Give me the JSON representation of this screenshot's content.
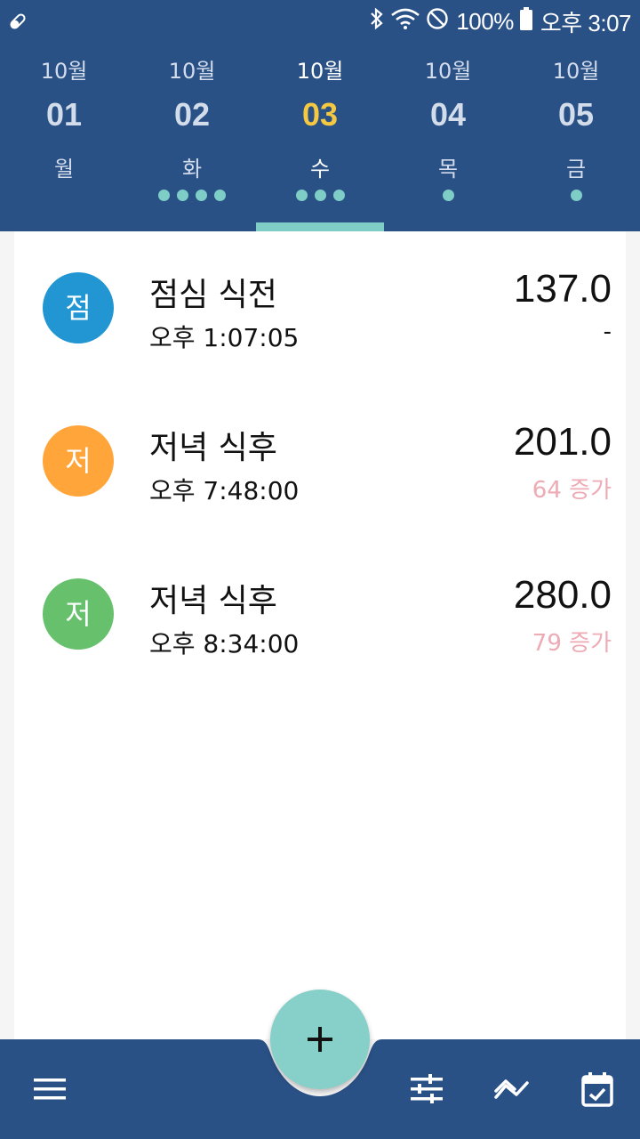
{
  "status_bar": {
    "battery": "100%",
    "time": "오후 3:07",
    "icons": [
      "pill-icon",
      "bluetooth-icon",
      "wifi-icon",
      "do-not-disturb-icon",
      "battery-icon"
    ]
  },
  "days": [
    {
      "month": "10월",
      "date": "01",
      "weekday": "월",
      "dots": 0,
      "selected": false
    },
    {
      "month": "10월",
      "date": "02",
      "weekday": "화",
      "dots": 4,
      "selected": false
    },
    {
      "month": "10월",
      "date": "03",
      "weekday": "수",
      "dots": 3,
      "selected": true
    },
    {
      "month": "10월",
      "date": "04",
      "weekday": "목",
      "dots": 1,
      "selected": false
    },
    {
      "month": "10월",
      "date": "05",
      "weekday": "금",
      "dots": 1,
      "selected": false
    }
  ],
  "entries": [
    {
      "initial": "점",
      "title": "점심 식전",
      "time": "오후 1:07:05",
      "value": "137.0",
      "diff": "-",
      "color": "#2196d3"
    },
    {
      "initial": "저",
      "title": "저녁 식후",
      "time": "오후 7:48:00",
      "value": "201.0",
      "diff": "64 증가",
      "color": "#ffa53a"
    },
    {
      "initial": "저",
      "title": "저녁 식후",
      "time": "오후 8:34:00",
      "value": "280.0",
      "diff": "79 증가",
      "color": "#66c06c"
    }
  ],
  "colors": {
    "header": "#2a5186",
    "accent": "#7ecdc7",
    "selected_date": "#f5c842",
    "increase": "#eeaab5"
  },
  "bottom_nav": {
    "icons": [
      "menu-icon",
      "add-icon",
      "sliders-icon",
      "trend-icon",
      "calendar-check-icon"
    ]
  }
}
